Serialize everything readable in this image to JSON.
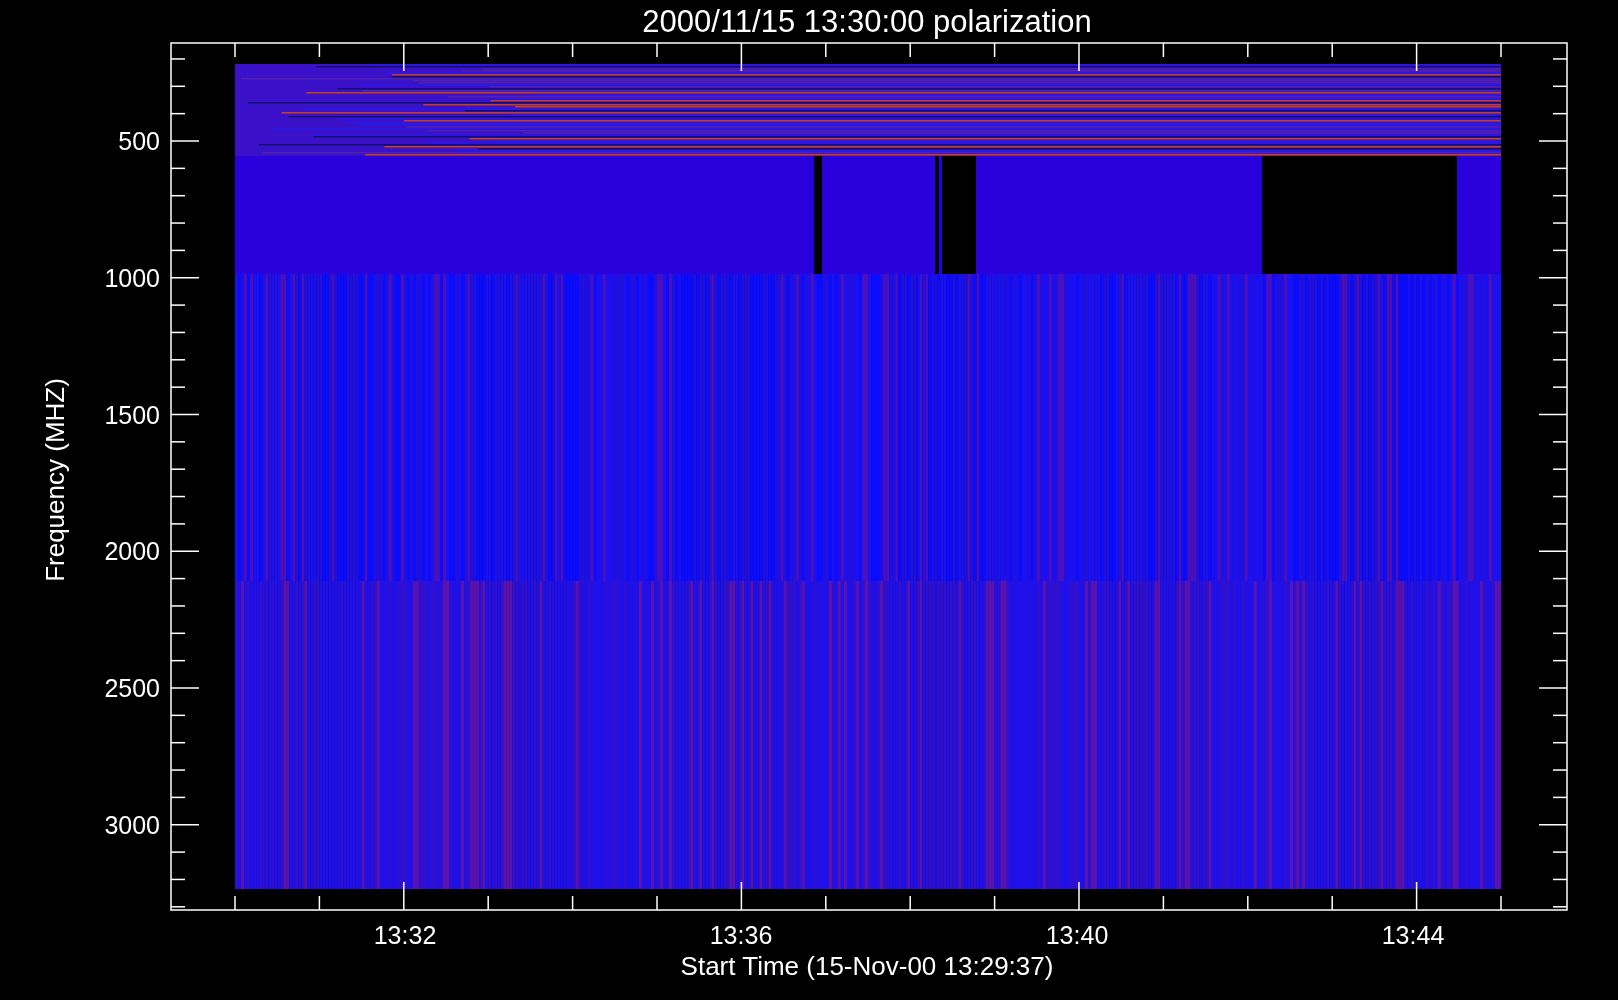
{
  "title": "2000/11/15 13:30:00 polarization",
  "y_axis": {
    "label": "Frequency (MHZ)",
    "tick_labels": [
      "500",
      "1000",
      "1500",
      "2000",
      "2500",
      "3000"
    ]
  },
  "x_axis": {
    "label": "Start Time (15-Nov-00 13:29:37)",
    "tick_labels": [
      "13:32",
      "13:36",
      "13:40",
      "13:44"
    ]
  }
}
